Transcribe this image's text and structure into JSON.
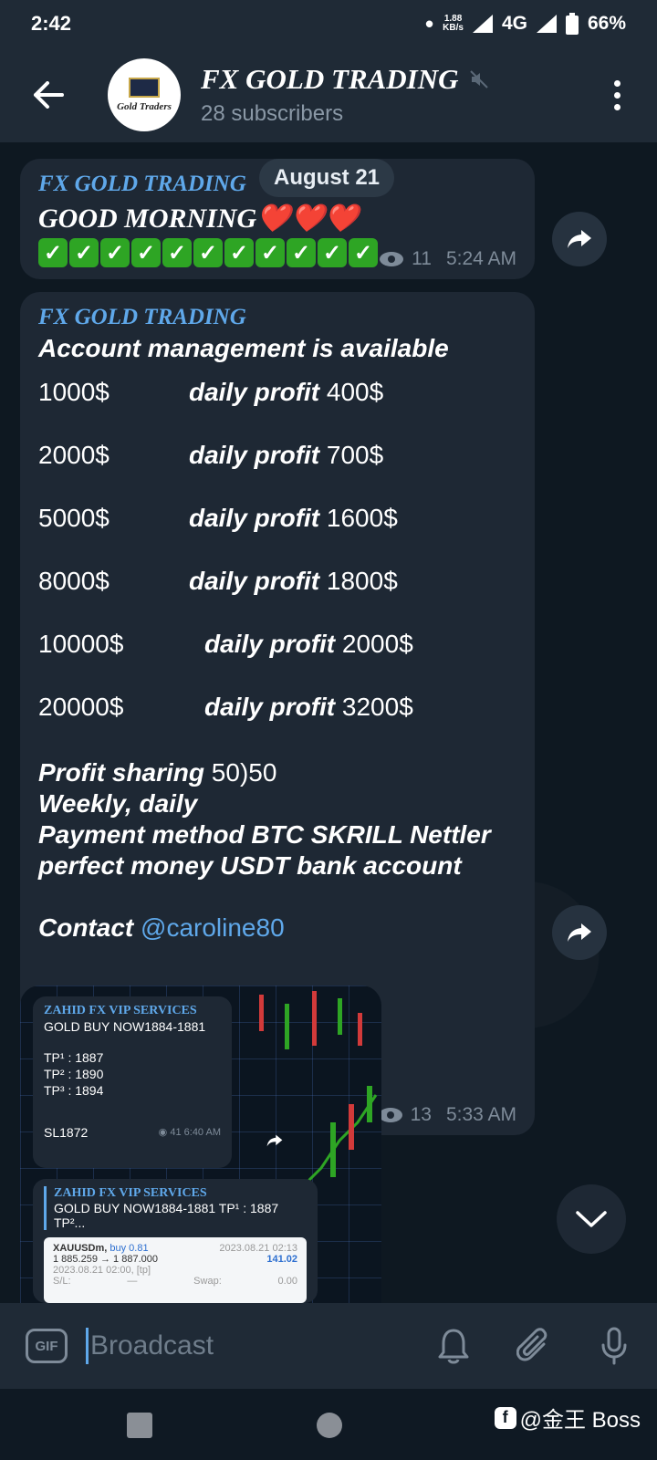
{
  "status": {
    "time": "2:42",
    "speed_top": "1.88",
    "speed_bottom": "KB/s",
    "network": "4G",
    "battery": "66%"
  },
  "header": {
    "title": "FX GOLD TRADING",
    "subtitle": "28 subscribers",
    "avatar_text": "Gold Traders"
  },
  "date_pill": "August 21",
  "msg1": {
    "sender": "FX GOLD TRADING",
    "text": "GOOD MORNING",
    "hearts": "❤️❤️❤️",
    "check_glyph": "✓",
    "check_count": 11,
    "views": "11",
    "time": "5:24 AM"
  },
  "msg2": {
    "sender": "FX GOLD TRADING",
    "headline": "Account management is available",
    "rows": [
      {
        "amount": "1000$",
        "label": "daily profit",
        "profit": "400$"
      },
      {
        "amount": "2000$",
        "label": "daily profit",
        "profit": "700$"
      },
      {
        "amount": "5000$",
        "label": "daily profit",
        "profit": "1600$"
      },
      {
        "amount": "8000$",
        "label": "daily profit",
        "profit": "1800$"
      },
      {
        "amount": "10000$",
        "label": "daily profit",
        "profit": "2000$"
      },
      {
        "amount": "20000$",
        "label": "daily profit",
        "profit": "3200$"
      }
    ],
    "sharing_label": "Profit sharing",
    "sharing_value": "50)50",
    "freq": "Weekly, daily",
    "payment_line1": "Payment method BTC SKRILL Nettler",
    "payment_line2": "perfect money USDT bank account",
    "contact_label": "Contact",
    "contact_handle": "@caroline80",
    "views": "13",
    "time": "5:33 AM"
  },
  "photo": {
    "inner1": {
      "sender": "ZAHID FX VIP SERVICES",
      "line1": "GOLD BUY NOW1884-1881",
      "tp1": "TP¹ : 1887",
      "tp2": "TP² : 1890",
      "tp3": "TP³ : 1894",
      "sl": "SL1872",
      "views": "41",
      "time": "6:40 AM"
    },
    "inner2": {
      "sender": "ZAHID FX VIP SERVICES",
      "line1": "GOLD BUY NOW1884-1881  TP¹ : 1887 TP²...",
      "sym": "XAUUSDm,",
      "side": "buy 0.81",
      "stamp": "2023.08.21 02:13",
      "price": "1 885.259 → 1 887.000",
      "pl": "141.02",
      "opened": "2023.08.21 02:00, [tp]",
      "sl_label": "S/L:",
      "sl_val": "—",
      "swap_label": "Swap:",
      "swap_val": "0.00"
    }
  },
  "input": {
    "placeholder": "Broadcast",
    "gif_label": "GIF"
  },
  "watermark": "@金王 Boss",
  "colors": {
    "accent": "#5fa8ea",
    "bubble": "#1e2834",
    "header": "#1f2a36",
    "check": "#2ea524"
  }
}
